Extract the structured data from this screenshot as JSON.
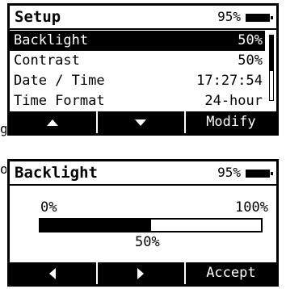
{
  "setup": {
    "title": "Setup",
    "battery": "95%",
    "items": [
      {
        "label": "Backlight",
        "value": "50%"
      },
      {
        "label": "Contrast",
        "value": "50%"
      },
      {
        "label": "Date / Time",
        "value": "17:27:54"
      },
      {
        "label": "Time Format",
        "value": "24-hour"
      }
    ],
    "softkeys": {
      "up": "up-arrow",
      "down": "down-arrow",
      "modify": "Modify"
    }
  },
  "backlight": {
    "title": "Backlight",
    "battery": "95%",
    "min": "0%",
    "max": "100%",
    "level_label": "50%",
    "level": 0.5,
    "softkeys": {
      "left": "left-arrow",
      "right": "right-arrow",
      "accept": "Accept"
    }
  },
  "side_marks": [
    "g",
    "o"
  ]
}
